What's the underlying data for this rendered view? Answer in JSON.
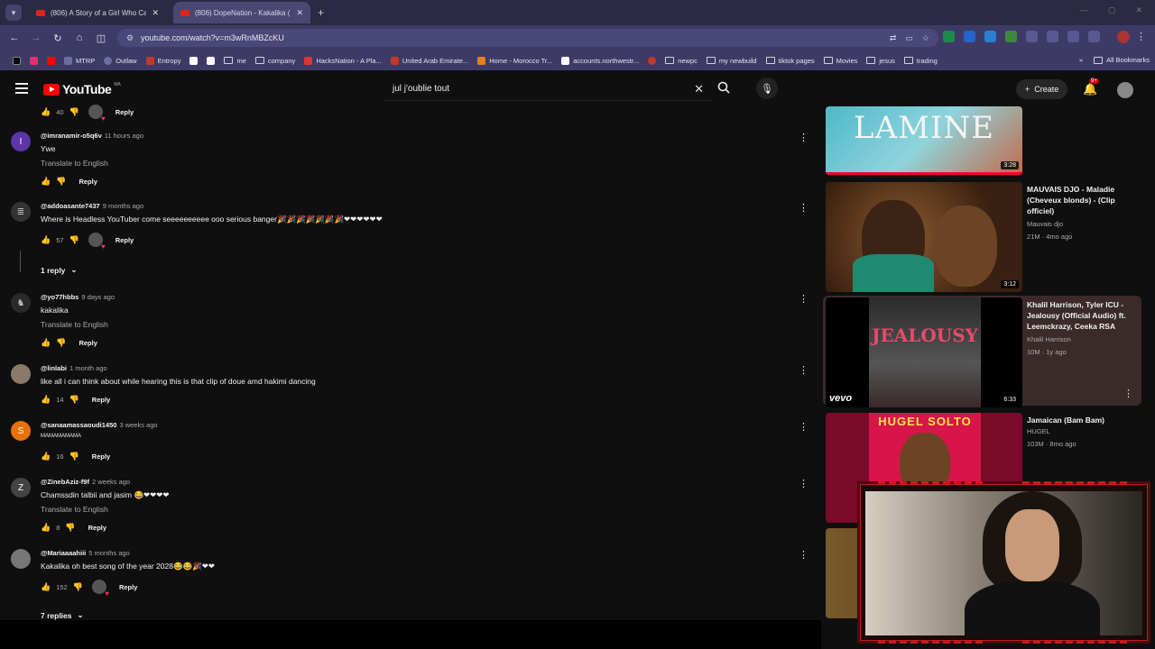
{
  "browser": {
    "tabs": [
      {
        "title": "(806) A Story of a Girl Who Ca"
      },
      {
        "title": "(806) DopeNation - Kakalika (M"
      }
    ],
    "url": "youtube.com/watch?v=m3wRnMBZcKU",
    "bookmarks": [
      "MTRP",
      "Outlaw",
      "Entropy",
      "me",
      "company",
      "HacksNation - A Pla...",
      "United Arab Emirate...",
      "Home - Morocco Tr...",
      "accounts.northwestr...",
      "newpc",
      "my newbuild",
      "tiktok pages",
      "Movies",
      "jesus",
      "trading"
    ],
    "all_bookmarks": "All Bookmarks"
  },
  "youtube": {
    "logo": "YouTube",
    "country": "MA",
    "search_value": "jul j'oublie tout",
    "create_label": "Create",
    "notif_count": "9+"
  },
  "comments": [
    {
      "avatar_letter": "",
      "avatar_color": "#555",
      "user": "",
      "time": "",
      "text": "",
      "translate": "",
      "likes": "40",
      "has_heart": true
    },
    {
      "avatar_letter": "I",
      "avatar_color": "#5c35a8",
      "user": "@imranamir-o5q6v",
      "time": "11 hours ago",
      "text": "Ywe",
      "translate": "Translate to English",
      "likes": "",
      "has_heart": false
    },
    {
      "avatar_letter": "",
      "avatar_color": "#777",
      "user": "@addoasante7437",
      "time": "9 months ago",
      "text": "Where is Headless YouTuber come seeeeeeeeee ooo serious banger🎉🎉🎉🎉🎉🎉🎉❤❤❤❤❤❤",
      "translate": "",
      "likes": "57",
      "has_heart": true
    },
    {
      "avatar_letter": "",
      "avatar_color": "#666",
      "user": "@yo77hbbs",
      "time": "9 days ago",
      "text": "kakalika",
      "translate": "Translate to English",
      "likes": "",
      "has_heart": false
    },
    {
      "avatar_letter": "",
      "avatar_color": "#8a7a6a",
      "user": "@linlabi",
      "time": "1 month ago",
      "text": "like all i can think about while hearing this is that clip of doue amd hakimi dancing",
      "translate": "",
      "likes": "14",
      "has_heart": false
    },
    {
      "avatar_letter": "S",
      "avatar_color": "#e8710a",
      "user": "@sanaamassaoudi1450",
      "time": "3 weeks ago",
      "text": "MAMAMAMAMA",
      "translate": "",
      "likes": "16",
      "has_heart": false
    },
    {
      "avatar_letter": "Z",
      "avatar_color": "#555",
      "user": "@ZinebAziz-f9f",
      "time": "2 weeks ago",
      "text": "Chamssdin talbii and jasim 😂❤❤❤❤",
      "translate": "Translate to English",
      "likes": "8",
      "has_heart": false
    },
    {
      "avatar_letter": "",
      "avatar_color": "#777",
      "user": "@Mariaaaahiii",
      "time": "5 months ago",
      "text": "Kakalika oh best song of the year 2028😂😂🎉❤❤",
      "translate": "",
      "likes": "152",
      "has_heart": true
    }
  ],
  "reply_label": "Reply",
  "replies_toggles": [
    "1 reply",
    "7 replies"
  ],
  "sidebar": [
    {
      "title": "",
      "channel": "",
      "meta": "",
      "duration": "3:28",
      "thumb_text": "LAMINE",
      "bg": "#4fb8c8"
    },
    {
      "title": "MAUVAIS DJO - Maladie (Cheveux blonds) - (Clip officiel)",
      "channel": "Mauvais djo",
      "meta": "21M · 4mo ago",
      "duration": "3:12",
      "thumb_text": "",
      "bg": "#5a3a22"
    },
    {
      "title": "Khalil Harrison, Tyler ICU - Jealousy (Official Audio) ft. Leemckrazy, Ceeka RSA",
      "channel": "Khalil Harrison",
      "meta": "10M · 1y ago",
      "duration": "6:33",
      "thumb_text": "JEALOUSY",
      "bg": "#000000"
    },
    {
      "title": "Jamaican (Bam Bam)",
      "channel": "HUGEL",
      "meta": "103M · 8mo ago",
      "duration": "",
      "thumb_text": "HUGEL SOLTO",
      "bg": "#a01038"
    }
  ]
}
